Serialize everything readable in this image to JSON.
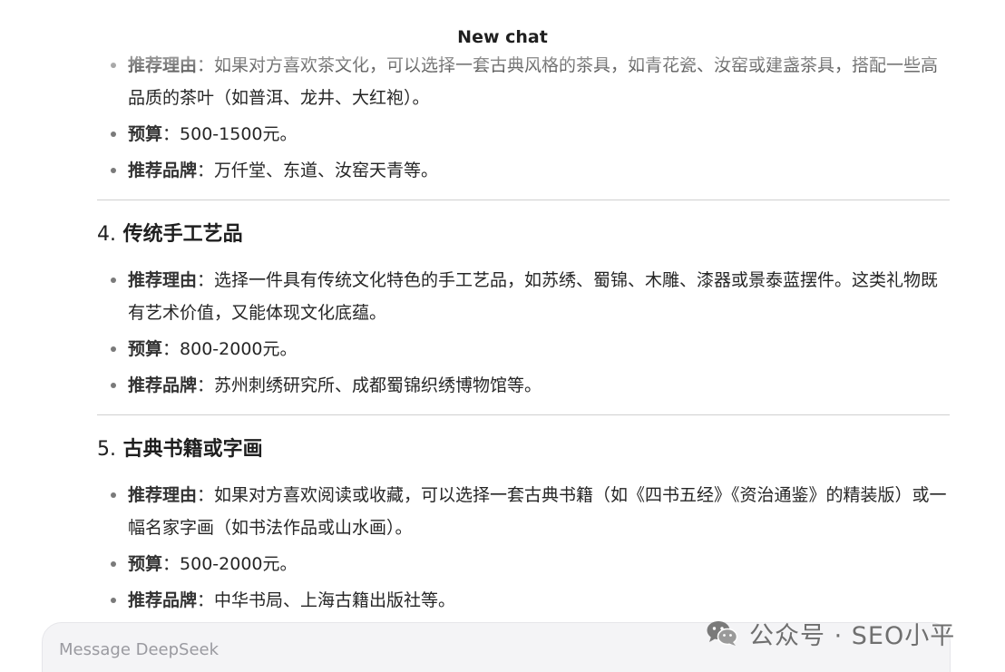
{
  "header": {
    "title": "New chat"
  },
  "sections": [
    {
      "items": [
        {
          "label": "推荐理由",
          "sep": "：",
          "text": "如果对方喜欢茶文化，可以选择一套古典风格的茶具，如青花瓷、汝窑或建盏茶具，搭配一些高品质的茶叶（如普洱、龙井、大红袍）。"
        },
        {
          "label": "预算",
          "sep": "：",
          "text": "500-1500元。"
        },
        {
          "label": "推荐品牌",
          "sep": "：",
          "text": "万仟堂、东道、汝窑天青等。"
        }
      ]
    },
    {
      "number": "4.",
      "title": "传统手工艺品",
      "items": [
        {
          "label": "推荐理由",
          "sep": "：",
          "text": "选择一件具有传统文化特色的手工艺品，如苏绣、蜀锦、木雕、漆器或景泰蓝摆件。这类礼物既有艺术价值，又能体现文化底蕴。"
        },
        {
          "label": "预算",
          "sep": "：",
          "text": "800-2000元。"
        },
        {
          "label": "推荐品牌",
          "sep": "：",
          "text": "苏州刺绣研究所、成都蜀锦织绣博物馆等。"
        }
      ]
    },
    {
      "number": "5.",
      "title": "古典书籍或字画",
      "items": [
        {
          "label": "推荐理由",
          "sep": "：",
          "text": "如果对方喜欢阅读或收藏，可以选择一套古典书籍（如《四书五经》《资治通鉴》的精装版）或一幅名家字画（如书法作品或山水画）。"
        },
        {
          "label": "预算",
          "sep": "：",
          "text": "500-2000元。"
        },
        {
          "label": "推荐品牌",
          "sep": "：",
          "text": "中华书局、上海古籍出版社等。"
        }
      ]
    }
  ],
  "composer": {
    "placeholder": "Message DeepSeek"
  },
  "watermark": {
    "text": "公众号 · SEO小平",
    "icon": "wechat-icon"
  },
  "colors": {
    "text": "#262626",
    "divider": "#cfcfcf",
    "composer_bg": "#f4f4f6"
  }
}
